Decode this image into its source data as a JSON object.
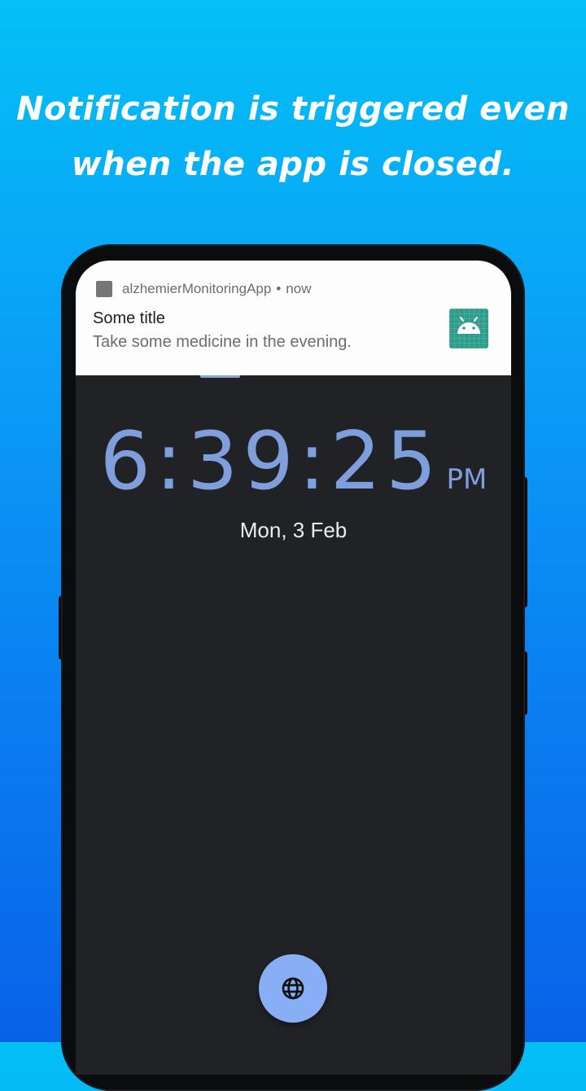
{
  "headline": {
    "line1": "Notification is triggered even",
    "line2": "when the app is closed."
  },
  "notification": {
    "app_name": "alzhemierMonitoringApp",
    "separator": "•",
    "time": "now",
    "title": "Some title",
    "text": "Take some medicine in the evening.",
    "large_icon": "android-icon",
    "accent": "#2f9d8b"
  },
  "clock": {
    "time": "6:39:25",
    "ampm": "PM",
    "date": "Mon, 3 Feb",
    "color": "#7f9fdc"
  },
  "fab": {
    "icon": "globe-icon",
    "color": "#88aef6"
  }
}
